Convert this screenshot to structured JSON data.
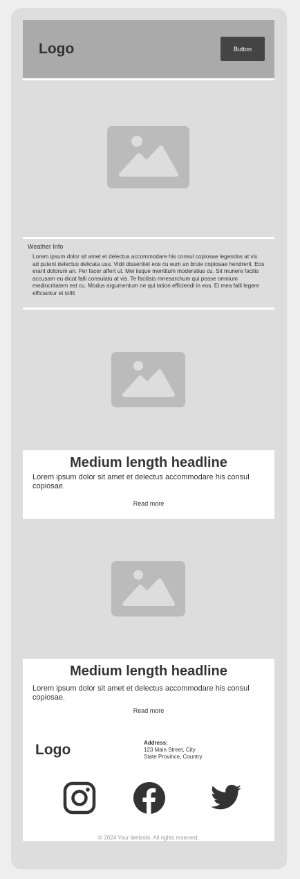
{
  "header": {
    "logo": "Logo",
    "button_label": "Button"
  },
  "weather": {
    "title": "Weather Info",
    "body": "Lorem ipsum dolor sit amet et delectus accommodare his consul copiosae legendos at vix ad putent delectus delicata usu. Vidit dissentiet eos cu eum an brute copiosae hendrerit. Eos erant dolorum an. Per facer affert ut. Mei iisque mentitum moderatius cu. Sit munere facilis accusam eu dicat falli consulatu at vis. Te facilisis mnesarchum qui posse omnium mediocritatem est cu. Modus argumentum ne qui tation efficiendi in eos. Ei mea falli legere efficiantur et tollit"
  },
  "cards": [
    {
      "headline": "Medium length headline",
      "body": "Lorem ipsum dolor sit amet et delectus accommodare his consul copiosae.",
      "link": "Read more"
    },
    {
      "headline": "Medium length headline",
      "body": "Lorem ipsum dolor sit amet et delectus accommodare his consul copiosae.",
      "link": "Read more"
    }
  ],
  "footer": {
    "logo": "Logo",
    "address_label": "Address:",
    "address_line1": "123 Main Street, City",
    "address_line2": "State Province, Country",
    "copyright": "© 2024 Your Website. All rights reserved.",
    "social": [
      "instagram-icon",
      "facebook-icon",
      "twitter-icon"
    ]
  },
  "colors": {
    "background": "#eeeeee",
    "frame": "#dddddd",
    "header": "#aaaaaa",
    "placeholder": "#bbbbbb",
    "button": "#444444",
    "text": "#333333"
  }
}
